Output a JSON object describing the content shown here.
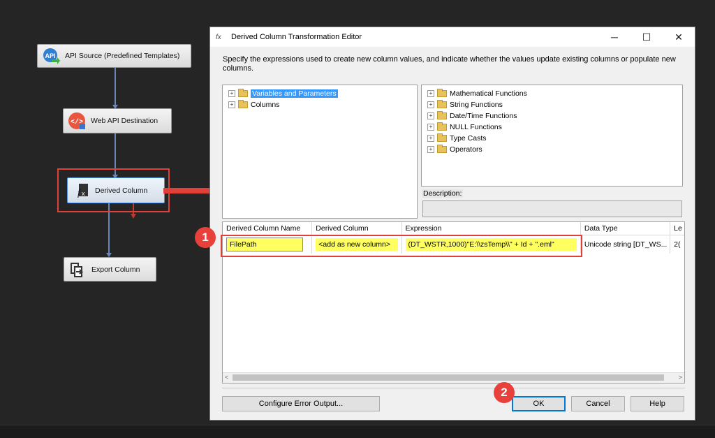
{
  "canvas": {
    "nodes": [
      {
        "label": "API Source (Predefined Templates)",
        "icon": "api-icon"
      },
      {
        "label": "Web API Destination",
        "icon": "code-icon"
      },
      {
        "label": "Derived Column",
        "icon": "fx-icon"
      },
      {
        "label": "Export Column",
        "icon": "export-icon"
      }
    ]
  },
  "dialog": {
    "title": "Derived Column Transformation Editor",
    "icon_label": "fx",
    "minimize": "─",
    "maximize": "☐",
    "close": "✕",
    "description": "Specify the expressions used to create new column values, and indicate whether the values update existing columns or populate new columns.",
    "left_tree": [
      {
        "label": "Variables and Parameters",
        "selected": true
      },
      {
        "label": "Columns",
        "selected": false
      }
    ],
    "right_tree": [
      {
        "label": "Mathematical Functions"
      },
      {
        "label": "String Functions"
      },
      {
        "label": "Date/Time Functions"
      },
      {
        "label": "NULL Functions"
      },
      {
        "label": "Type Casts"
      },
      {
        "label": "Operators"
      }
    ],
    "description_label": "Description:",
    "grid": {
      "columns": [
        "Derived Column Name",
        "Derived Column",
        "Expression",
        "Data Type",
        "Le"
      ],
      "rows": [
        {
          "name": "FilePath",
          "derived": "<add as new column>",
          "expression": "(DT_WSTR,1000)\"E:\\\\zsTemp\\\\\" + Id + \".eml\"",
          "data_type": "Unicode string [DT_WS...",
          "length": "2("
        }
      ]
    },
    "buttons": {
      "configure": "Configure Error Output...",
      "ok": "OK",
      "cancel": "Cancel",
      "help": "Help"
    }
  },
  "annotations": {
    "badge1": "1",
    "badge2": "2",
    "accent": "#e0403a"
  }
}
